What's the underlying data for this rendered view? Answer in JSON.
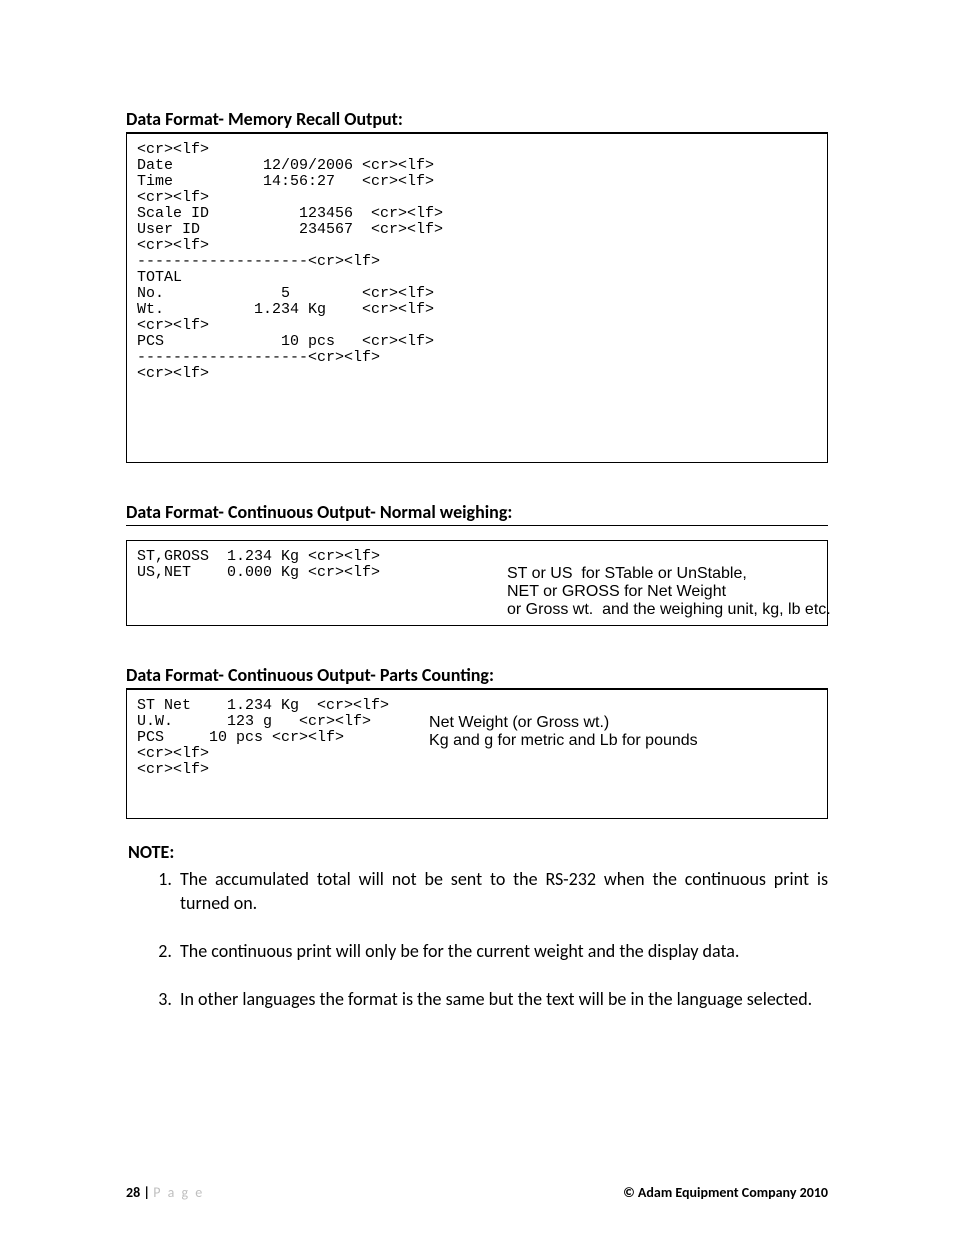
{
  "section1": {
    "heading": "Data Format- Memory Recall Output:",
    "text": "<cr><lf>\nDate          12/09/2006 <cr><lf>\nTime          14:56:27   <cr><lf>\n<cr><lf>\nScale ID          123456  <cr><lf>\nUser ID           234567  <cr><lf>\n<cr><lf>\n-------------------<cr><lf>\nTOTAL\nNo.             5        <cr><lf>\nWt.          1.234 Kg    <cr><lf>\n<cr><lf>\nPCS             10 pcs   <cr><lf>\n-------------------<cr><lf>\n<cr><lf>"
  },
  "section2": {
    "heading": "Data Format- Continuous Output- Normal weighing:",
    "left": "ST,GROSS  1.234 Kg <cr><lf>\nUS,NET    0.000 Kg <cr><lf>",
    "right": "ST or US  for STable or UnStable,\nNET or GROSS for Net Weight\nor Gross wt.  and the weighing unit, kg, lb etc."
  },
  "section3": {
    "heading": "Data Format- Continuous Output- Parts Counting:",
    "left": "ST Net    1.234 Kg  <cr><lf>\nU.W.      123 g   <cr><lf>\nPCS     10 pcs <cr><lf>\n<cr><lf>\n<cr><lf>",
    "right": "Net Weight (or Gross wt.)\nKg and g for metric and Lb for pounds"
  },
  "note": {
    "heading": "NOTE:",
    "items": [
      "The accumulated total will not be sent to the RS-232 when the continuous print is turned on.",
      "The continuous print will only be for the current weight and the display data.",
      "In other languages the format is the same but the text will be in the language selected."
    ]
  },
  "footer": {
    "page_num": "28 | ",
    "page_word": "P a g e",
    "copyright": "© Adam Equipment Company 2010"
  }
}
